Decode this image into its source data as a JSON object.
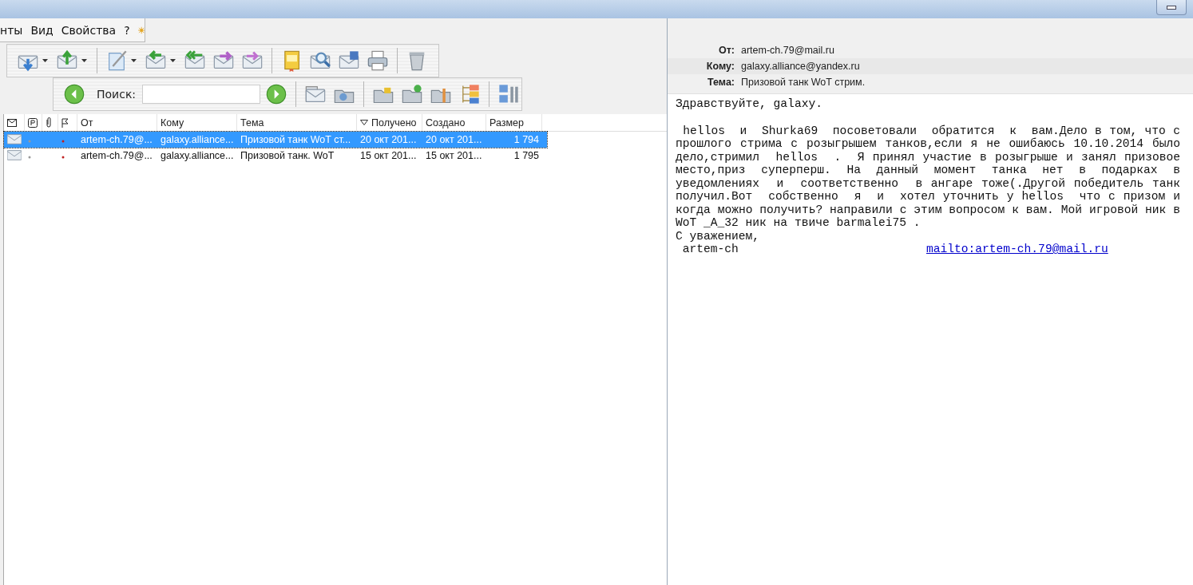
{
  "menu": [
    "нты",
    "Вид",
    "Свойства",
    "?"
  ],
  "search": {
    "label": "Поиск:"
  },
  "message_list": {
    "columns": [
      {
        "label": "От",
        "sorted": false
      },
      {
        "label": "Кому",
        "sorted": false
      },
      {
        "label": "Тема",
        "sorted": false
      },
      {
        "label": "Получено",
        "sorted": true
      },
      {
        "label": "Создано",
        "sorted": false
      },
      {
        "label": "Размер",
        "sorted": false
      }
    ],
    "rows": [
      {
        "from": "artem-ch.79@...",
        "to": "galaxy.alliance...",
        "subject": "Призовой танк WoT ст...",
        "received": "20 окт 201...",
        "created": "20 окт 201...",
        "size": "1 794",
        "selected": true
      },
      {
        "from": "artem-ch.79@...",
        "to": "galaxy.alliance...",
        "subject": "Призовой танк. WoT",
        "received": "15 окт 201...",
        "created": "15 окт 201...",
        "size": "1 795",
        "selected": false
      }
    ]
  },
  "preview": {
    "headers": [
      {
        "label": "От:",
        "value": "artem-ch.79@mail.ru"
      },
      {
        "label": "Кому:",
        "value": "galaxy.alliance@yandex.ru"
      },
      {
        "label": "Тема:",
        "value": "Призовой танк WoT стрим."
      }
    ],
    "greeting": "Здравствуйте, galaxy.",
    "body": " hellos  и  Shurka69  посоветовали  обратится  к  вам.Дело в том, что с прошлого стрима с розыгрышем танков,если я не ошибаюсь 10.10.2014 было дело,стримил  hellos  .  Я принял участие в розыгрыше и занял призовое место,приз  суперперш.  На  данный  момент  танка  нет  в  подарках  в уведомлениях  и  соответственно  в ангаре тоже(.Другой победитель танк получил.Вот  собственно  я  и  хотел уточнить у hellos  что с призом и когда можно получить? направили с этим вопросом к вам. Мой игровой ник в WoT _A_32 ник на твиче barmalei75 .",
    "closing": "С уважением,",
    "signature": " artem-ch",
    "link": "mailto:artem-ch.79@mail.ru"
  }
}
